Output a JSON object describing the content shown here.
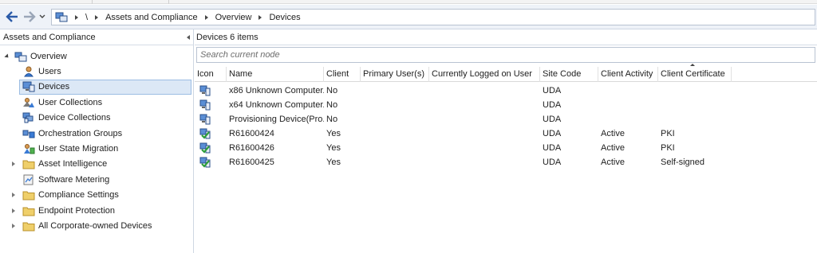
{
  "address_bar": {
    "root_label": "\\",
    "crumbs": [
      "Assets and Compliance",
      "Overview",
      "Devices"
    ]
  },
  "left_pane": {
    "title": "Assets and Compliance",
    "tree": [
      {
        "label": "Overview",
        "icon": "overview-icon",
        "level": 0,
        "expander": "expanded"
      },
      {
        "label": "Users",
        "icon": "user-icon",
        "level": 1
      },
      {
        "label": "Devices",
        "icon": "device-icon",
        "level": 1,
        "selected": true
      },
      {
        "label": "User Collections",
        "icon": "user-collection-icon",
        "level": 1
      },
      {
        "label": "Device Collections",
        "icon": "device-collection-icon",
        "level": 1
      },
      {
        "label": "Orchestration Groups",
        "icon": "orchestration-icon",
        "level": 1
      },
      {
        "label": "User State Migration",
        "icon": "migration-icon",
        "level": 1
      },
      {
        "label": "Asset Intelligence",
        "icon": "folder-icon",
        "level": 1,
        "expander": "collapsed"
      },
      {
        "label": "Software Metering",
        "icon": "metering-icon",
        "level": 1
      },
      {
        "label": "Compliance Settings",
        "icon": "folder-icon",
        "level": 1,
        "expander": "collapsed"
      },
      {
        "label": "Endpoint Protection",
        "icon": "folder-icon",
        "level": 1,
        "expander": "collapsed"
      },
      {
        "label": "All Corporate-owned Devices",
        "icon": "folder-icon",
        "level": 1,
        "expander": "collapsed"
      }
    ]
  },
  "right_pane": {
    "title": "Devices 6 items",
    "search_placeholder": "Search current node",
    "columns": [
      "Icon",
      "Name",
      "Client",
      "Primary User(s)",
      "Currently Logged on User",
      "Site Code",
      "Client Activity",
      "Client Certificate"
    ],
    "sorted_column": "Client Certificate",
    "rows": [
      {
        "icon": "unknown-computer-icon",
        "name": "x86 Unknown Computer...",
        "client": "No",
        "primary_user": "",
        "logged_on": "",
        "site_code": "UDA",
        "activity": "",
        "certificate": ""
      },
      {
        "icon": "unknown-computer-icon",
        "name": "x64 Unknown Computer...",
        "client": "No",
        "primary_user": "",
        "logged_on": "",
        "site_code": "UDA",
        "activity": "",
        "certificate": ""
      },
      {
        "icon": "unknown-computer-icon",
        "name": "Provisioning Device(Pro...",
        "client": "No",
        "primary_user": "",
        "logged_on": "",
        "site_code": "UDA",
        "activity": "",
        "certificate": ""
      },
      {
        "icon": "managed-computer-icon",
        "name": "R61600424",
        "client": "Yes",
        "primary_user": "",
        "logged_on": "",
        "site_code": "UDA",
        "activity": "Active",
        "certificate": "PKI"
      },
      {
        "icon": "managed-computer-icon",
        "name": "R61600426",
        "client": "Yes",
        "primary_user": "",
        "logged_on": "",
        "site_code": "UDA",
        "activity": "Active",
        "certificate": "PKI"
      },
      {
        "icon": "managed-computer-icon",
        "name": "R61600425",
        "client": "Yes",
        "primary_user": "",
        "logged_on": "",
        "site_code": "UDA",
        "activity": "Active",
        "certificate": "Self-signed"
      }
    ]
  },
  "colors": {
    "accent": "#3a7bd5",
    "selection": "#dce8f6",
    "addr_bg": "#eef2f8",
    "folder": "#e8c45a",
    "check_green": "#2e9e3a"
  }
}
